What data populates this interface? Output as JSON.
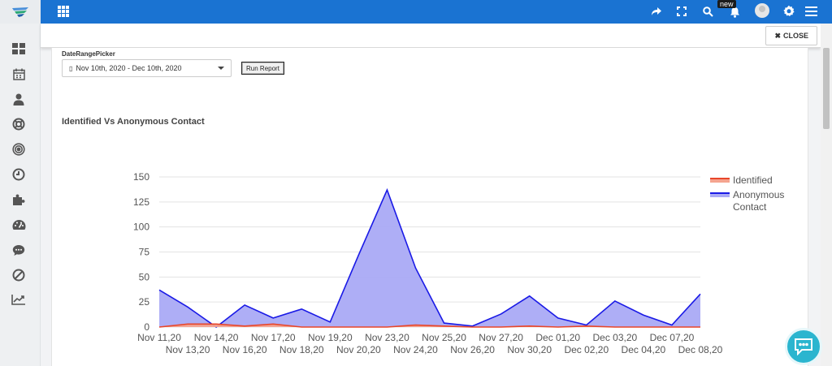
{
  "topbar": {
    "badge_new": "new",
    "colors": {
      "bar": "#1a73d2",
      "icon": "#ffffff"
    },
    "icons": [
      "apps-icon",
      "share-icon",
      "fullscreen-icon",
      "search-icon",
      "bell-icon",
      "avatar",
      "gear-icon",
      "menu-icon"
    ]
  },
  "sidebar": {
    "items": [
      {
        "icon": "dashboard-icon"
      },
      {
        "icon": "calendar-icon"
      },
      {
        "icon": "user-icon"
      },
      {
        "icon": "lifebuoy-icon"
      },
      {
        "icon": "target-icon"
      },
      {
        "icon": "clock-icon"
      },
      {
        "icon": "puzzle-icon"
      },
      {
        "icon": "speedometer-icon"
      },
      {
        "icon": "chat-icon"
      },
      {
        "icon": "ban-icon"
      },
      {
        "icon": "trend-chart-icon"
      }
    ]
  },
  "close_bar": {
    "close_label": "CLOSE"
  },
  "report": {
    "date_picker_label": "DateRangePicker",
    "date_range_value": "Nov 10th, 2020 - Dec 10th, 2020",
    "run_button": "Run Report",
    "chart_title": "Identified Vs Anonymous Contact"
  },
  "chart_data": {
    "type": "area",
    "title": "Identified Vs Anonymous Contact",
    "xlabel": "",
    "ylabel": "",
    "ylim": [
      0,
      150
    ],
    "yticks": [
      0,
      25,
      50,
      75,
      100,
      125,
      150
    ],
    "grid": true,
    "legend_position": "right",
    "categories": [
      "Nov 11,20",
      "Nov 13,20",
      "Nov 14,20",
      "Nov 16,20",
      "Nov 17,20",
      "Nov 18,20",
      "Nov 19,20",
      "Nov 20,20",
      "Nov 23,20",
      "Nov 24,20",
      "Nov 25,20",
      "Nov 26,20",
      "Nov 27,20",
      "Nov 30,20",
      "Dec 01,20",
      "Dec 02,20",
      "Dec 03,20",
      "Dec 04,20",
      "Dec 07,20",
      "Dec 08,20"
    ],
    "series": [
      {
        "name": "Identified",
        "color": "#e8462a",
        "fill": "#f5a48f",
        "values": [
          0,
          3,
          3,
          1,
          3,
          0,
          0,
          0,
          0,
          2,
          1,
          0,
          0,
          1,
          0,
          1,
          0,
          0,
          0,
          0
        ]
      },
      {
        "name": "Anonymous Contact",
        "color": "#1a1ae6",
        "fill": "#aaaaf5",
        "values": [
          37,
          20,
          0,
          22,
          9,
          18,
          5,
          72,
          137,
          59,
          4,
          1,
          13,
          31,
          9,
          2,
          26,
          12,
          2,
          33
        ]
      }
    ]
  }
}
